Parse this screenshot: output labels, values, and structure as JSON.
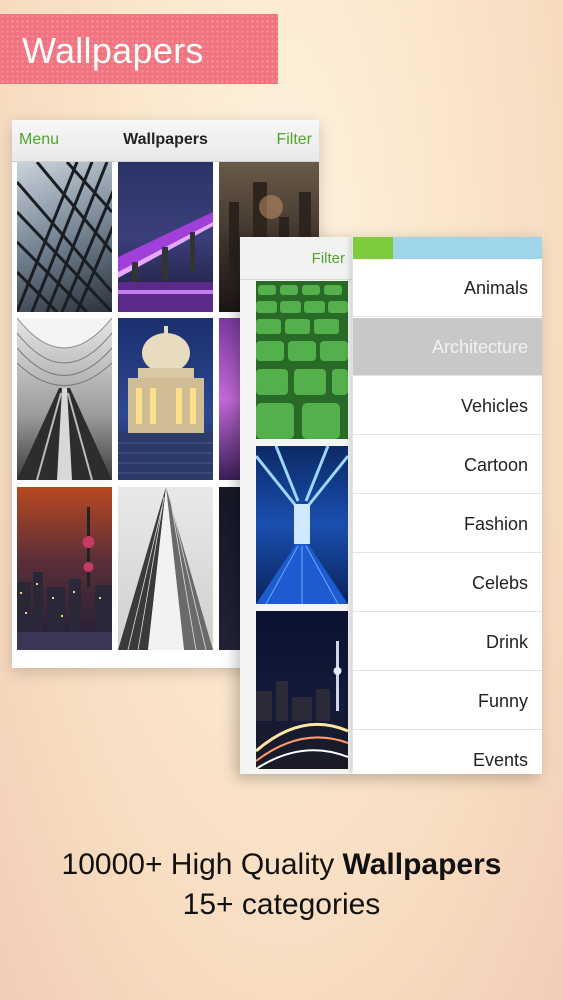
{
  "banner": {
    "title": "Wallpapers"
  },
  "back_screen": {
    "menu_label": "Menu",
    "title": "Wallpapers",
    "filter_label": "Filter",
    "thumbnails": [
      "steel-lattice-tower",
      "lit-bridge-night",
      "city-ruins-dusk",
      "train-station-hall",
      "capitol-dome-night",
      "purple-city-night",
      "tv-tower-skyline",
      "skyscraper-upward",
      "city-night-edge"
    ]
  },
  "front_screen": {
    "filter_label": "Filter",
    "thumbnails": [
      "stadium-seats-green",
      "blue-neon-tunnel",
      "sky-tower-night"
    ],
    "categories": [
      {
        "label": "Animals",
        "selected": false
      },
      {
        "label": "Architecture",
        "selected": true
      },
      {
        "label": "Vehicles",
        "selected": false
      },
      {
        "label": "Cartoon",
        "selected": false
      },
      {
        "label": "Fashion",
        "selected": false
      },
      {
        "label": "Celebs",
        "selected": false
      },
      {
        "label": "Drink",
        "selected": false
      },
      {
        "label": "Funny",
        "selected": false
      },
      {
        "label": "Events",
        "selected": false
      }
    ]
  },
  "tagline": {
    "line1_prefix": "10000+ High Quality ",
    "line1_bold": "Wallpapers",
    "line2": "15+ categories"
  },
  "colors": {
    "accent": "#4fa52d",
    "banner": "#f0737f",
    "selected_row": "#c8c8c8"
  }
}
